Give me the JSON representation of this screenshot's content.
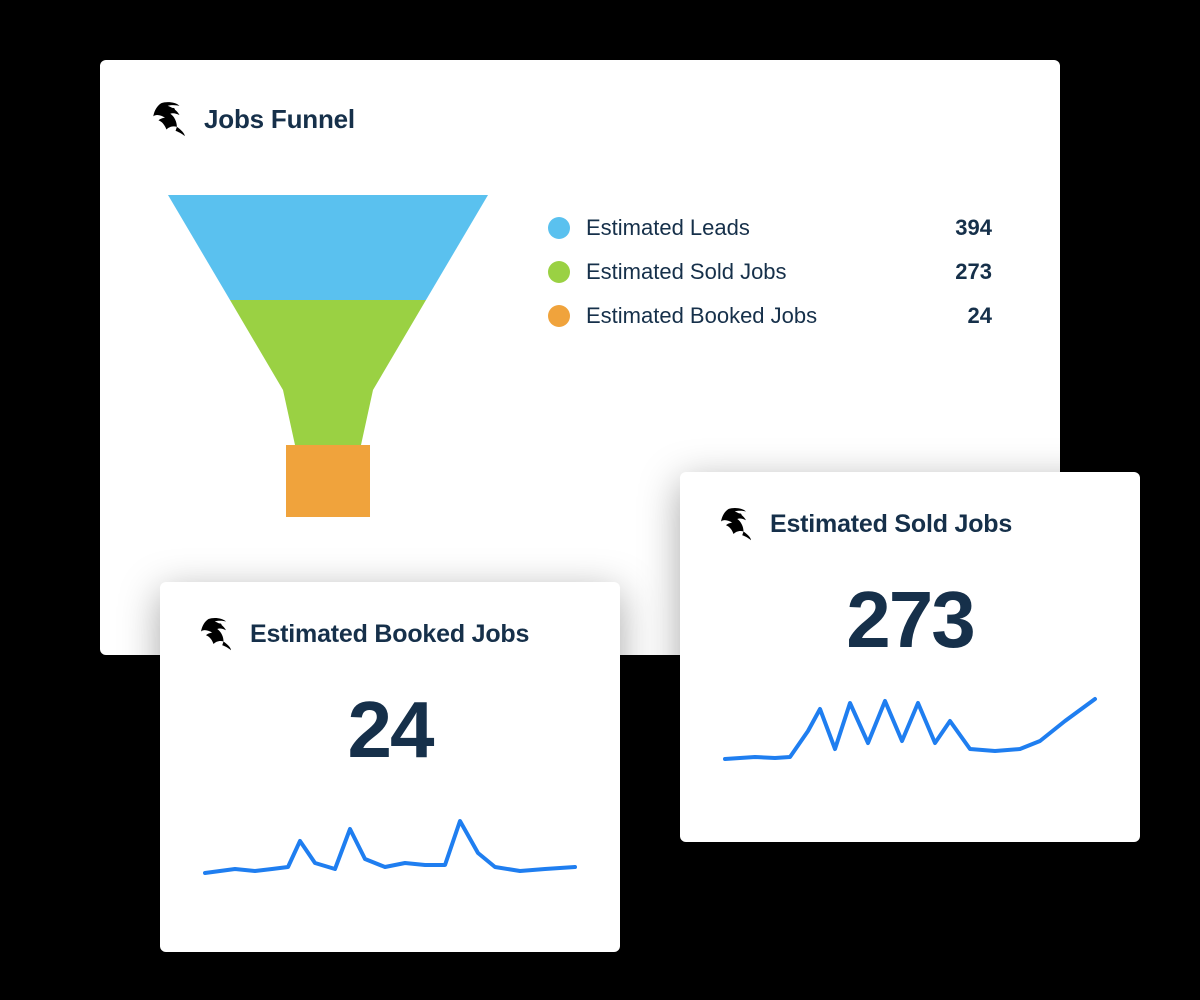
{
  "funnel": {
    "title": "Jobs Funnel",
    "legend": [
      {
        "label": "Estimated Leads",
        "value": "394",
        "color": "#5ac1ef"
      },
      {
        "label": "Estimated Sold Jobs",
        "value": "273",
        "color": "#9ad143"
      },
      {
        "label": "Estimated Booked Jobs",
        "value": "24",
        "color": "#f0a33c"
      }
    ]
  },
  "cards": {
    "booked": {
      "title": "Estimated Booked Jobs",
      "value": "24"
    },
    "sold": {
      "title": "Estimated Sold Jobs",
      "value": "273"
    }
  },
  "colors": {
    "textDark": "#16304a",
    "sparkline": "#1f7ef0"
  },
  "chart_data": [
    {
      "type": "bar",
      "title": "Jobs Funnel",
      "categories": [
        "Estimated Leads",
        "Estimated Sold Jobs",
        "Estimated Booked Jobs"
      ],
      "values": [
        394,
        273,
        24
      ],
      "series_colors": [
        "#5ac1ef",
        "#9ad143",
        "#f0a33c"
      ],
      "layout": "funnel"
    },
    {
      "type": "line",
      "title": "Estimated Booked Jobs",
      "x": [
        0,
        1,
        2,
        3,
        4,
        5,
        6,
        7,
        8,
        9,
        10,
        11,
        12,
        13,
        14,
        15,
        16,
        17,
        18,
        19
      ],
      "values": [
        18,
        20,
        19,
        20,
        22,
        45,
        28,
        22,
        55,
        30,
        22,
        26,
        24,
        24,
        60,
        35,
        22,
        20,
        21,
        22
      ],
      "total": 24
    },
    {
      "type": "line",
      "title": "Estimated Sold Jobs",
      "x": [
        0,
        1,
        2,
        3,
        4,
        5,
        6,
        7,
        8,
        9,
        10,
        11,
        12,
        13,
        14,
        15,
        16,
        17,
        18,
        19
      ],
      "values": [
        22,
        24,
        23,
        24,
        50,
        62,
        30,
        68,
        35,
        72,
        38,
        70,
        36,
        55,
        30,
        28,
        30,
        38,
        55,
        78
      ],
      "total": 273
    }
  ]
}
